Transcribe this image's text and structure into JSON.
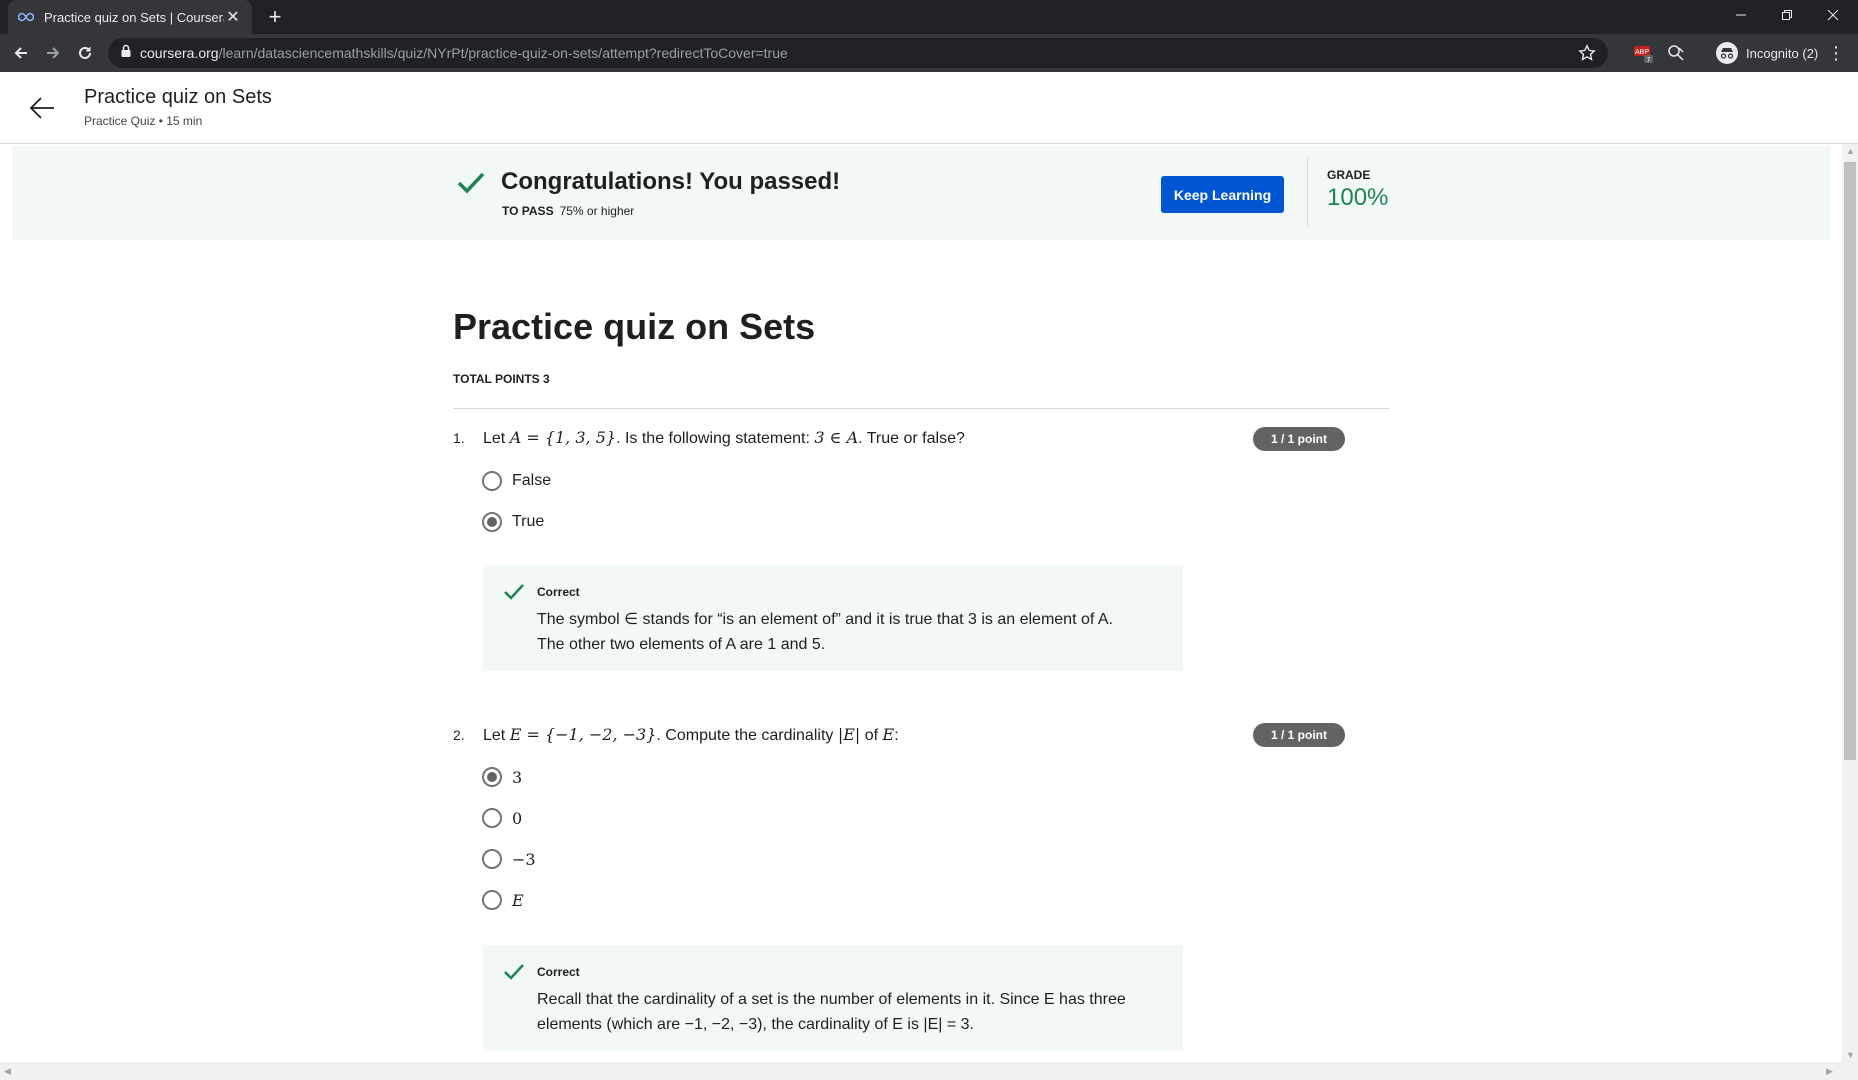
{
  "browser": {
    "tab_title": "Practice quiz on Sets | Coursera",
    "url_host": "coursera.org",
    "url_path": "/learn/datasciencemathskills/quiz/NYrPt/practice-quiz-on-sets/attempt?redirectToCover=true",
    "incognito_label": "Incognito (2)",
    "extension_badge": "7"
  },
  "header": {
    "title": "Practice quiz on Sets",
    "subtitle": "Practice Quiz • 15 min"
  },
  "banner": {
    "message": "Congratulations! You passed!",
    "to_pass_label": "TO PASS",
    "to_pass_value": "75% or higher",
    "button_label": "Keep Learning",
    "grade_label": "GRADE",
    "grade_value": "100%",
    "accent_color": "#1f8354",
    "button_color": "#0056d2"
  },
  "quiz": {
    "title": "Practice quiz on Sets",
    "total_points": "TOTAL POINTS 3",
    "questions": [
      {
        "number": "1.",
        "prompt_prefix": "Let ",
        "prompt_math1": "A = {1, 3, 5}",
        "prompt_middle": ". Is the following statement: ",
        "prompt_math2": "3 ∈ A",
        "prompt_suffix": ". True or false?",
        "points": "1 / 1 point",
        "options": [
          {
            "label": "False",
            "selected": false
          },
          {
            "label": "True",
            "selected": true
          }
        ],
        "feedback_heading": "Correct",
        "feedback_line1": "The symbol ∈ stands for “is an element of” and it is true that 3 is an element of A.",
        "feedback_line2": "The other two elements of A are 1 and 5."
      },
      {
        "number": "2.",
        "prompt_prefix": "Let ",
        "prompt_math1": "E = {−1, −2, −3}",
        "prompt_middle": ". Compute the cardinality ",
        "prompt_math2": "|E|",
        "prompt_middle2": " of ",
        "prompt_math3": "E",
        "prompt_suffix": ":",
        "points": "1 / 1 point",
        "options": [
          {
            "label": "3",
            "selected": true
          },
          {
            "label": "0",
            "selected": false
          },
          {
            "label": "−3",
            "selected": false
          },
          {
            "label": "E",
            "selected": false
          }
        ],
        "feedback_heading": "Correct",
        "feedback_line1": "Recall that the cardinality of a set is the number of elements in it. Since E has three",
        "feedback_line2": "elements (which are −1, −2, −3), the cardinality of E is |E| = 3."
      }
    ]
  },
  "icons": {
    "favicon": "coursera-infinity-icon",
    "back": "back-arrow-icon",
    "forward": "forward-arrow-icon",
    "reload": "reload-icon",
    "lock": "lock-icon",
    "bookmark": "star-icon",
    "check": "checkmark-icon"
  }
}
